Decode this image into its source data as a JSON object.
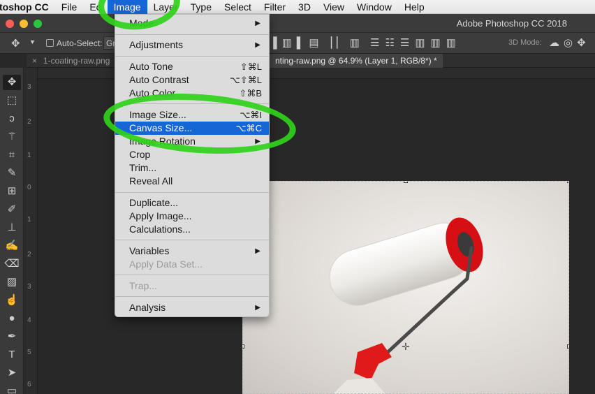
{
  "menubar": {
    "app_name": "toshop CC",
    "items": [
      "File",
      "Ec",
      "Image",
      "Layer",
      "Type",
      "Select",
      "Filter",
      "3D",
      "View",
      "Window",
      "Help"
    ]
  },
  "window": {
    "title": "Adobe Photoshop CC 2018"
  },
  "options_bar": {
    "auto_select_label": "Auto-Select:",
    "auto_select_value": "Gr",
    "mode_3d_label": "3D Mode:"
  },
  "tabs": [
    {
      "label": "1-coating-raw.png"
    },
    {
      "label": "nting-raw.png @ 64.9% (Layer 1, RGB/8*) *"
    }
  ],
  "ruler_v_labels": [
    "3",
    "2",
    "1",
    "0",
    "1",
    "2",
    "3",
    "4",
    "5",
    "6"
  ],
  "image_menu": {
    "mode": "Mode",
    "adjustments": "Adjustments",
    "auto_tone": "Auto Tone",
    "auto_tone_sc": "⇧⌘L",
    "auto_contrast": "Auto Contrast",
    "auto_contrast_sc": "⌥⇧⌘L",
    "auto_color": "Auto Color",
    "auto_color_sc": "⇧⌘B",
    "image_size": "Image Size...",
    "image_size_sc": "⌥⌘I",
    "canvas_size": "Canvas Size...",
    "canvas_size_sc": "⌥⌘C",
    "image_rotation": "Image Rotation",
    "crop": "Crop",
    "trim": "Trim...",
    "reveal_all": "Reveal All",
    "duplicate": "Duplicate...",
    "apply_image": "Apply Image...",
    "calculations": "Calculations...",
    "variables": "Variables",
    "apply_data_set": "Apply Data Set...",
    "trap": "Trap...",
    "analysis": "Analysis"
  },
  "colors": {
    "highlight": "#1766d6",
    "annotation": "#2fd11a"
  }
}
